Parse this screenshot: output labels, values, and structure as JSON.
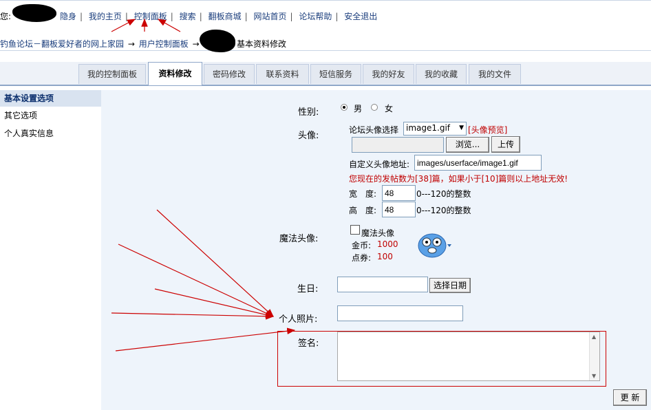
{
  "topbar": {
    "greeting": "您:",
    "links": [
      "隐身",
      "我的主页",
      "控制面板",
      "搜索",
      "翻板商城",
      "网站首页",
      "论坛帮助",
      "安全退出"
    ]
  },
  "breadcrumb": {
    "site": "钓鱼论坛－翻板爱好者的网上家园",
    "panel": "用户控制面板",
    "current": "基本资料修改"
  },
  "tabs": [
    "我的控制面板",
    "资料修改",
    "密码修改",
    "联系资料",
    "短信服务",
    "我的好友",
    "我的收藏",
    "我的文件"
  ],
  "active_tab": "资料修改",
  "sidebar": {
    "header": "基本设置选项",
    "items": [
      "其它选项",
      "个人真实信息"
    ]
  },
  "form": {
    "gender_label": "性别:",
    "gender_options": [
      "男",
      "女"
    ],
    "gender_selected": "男",
    "avatar_label": "头像:",
    "avatar_select_label": "论坛头像选择",
    "avatar_select_value": "image1.gif",
    "avatar_preview_link": "[头像预览]",
    "browse_button": "浏览...",
    "upload_button": "上传",
    "custom_avatar_label": "自定义头像地址:",
    "custom_avatar_value": "images/userface/image1.gif",
    "post_count_notice": "您现在的发帖数为[38]篇，如果小于[10]篇则以上地址无效!",
    "width_label": "宽　度:",
    "width_value": "48",
    "width_hint": "0---120的整数",
    "height_label": "高　度:",
    "height_value": "48",
    "height_hint": "0---120的整数",
    "magic_avatar_label": "魔法头像:",
    "magic_checkbox_label": "魔法头像",
    "gold_label": "金币:",
    "gold_value": "1000",
    "coupon_label": "点券:",
    "coupon_value": "100",
    "birthday_label": "生日:",
    "birthday_value": "",
    "pick_date_button": "选择日期",
    "photo_label": "个人照片:",
    "photo_value": "",
    "signature_label": "签名:",
    "signature_value": "",
    "submit_button": "更 新"
  },
  "colors": {
    "link": "#1a3d7c",
    "tab_border": "#8ea6c8",
    "form_bg": "#eef4fb",
    "sidebar_header_bg": "#d9e3f0",
    "annotation_red": "#cc0000"
  }
}
